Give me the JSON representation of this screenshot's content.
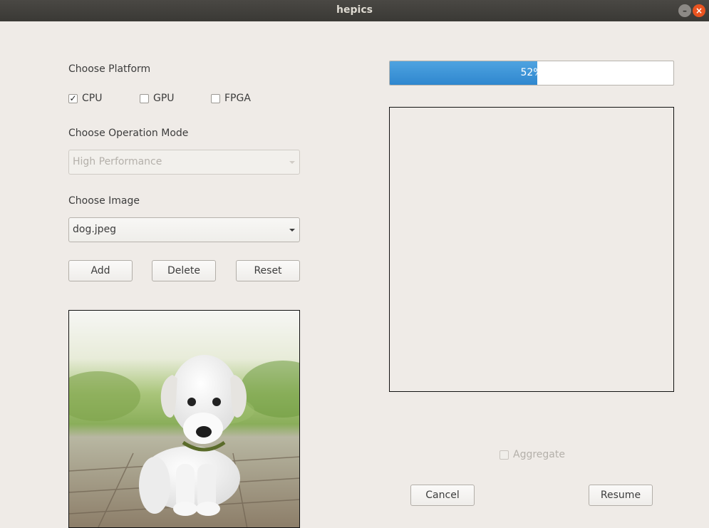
{
  "window": {
    "title": "hepics"
  },
  "platform": {
    "heading": "Choose Platform",
    "options": [
      {
        "label": "CPU",
        "checked": true
      },
      {
        "label": "GPU",
        "checked": false
      },
      {
        "label": "FPGA",
        "checked": false
      }
    ]
  },
  "mode": {
    "heading": "Choose Operation Mode",
    "selected": "High Performance",
    "enabled": false
  },
  "image": {
    "heading": "Choose Image",
    "selected": "dog.jpeg"
  },
  "actions": {
    "add": "Add",
    "delete": "Delete",
    "reset": "Reset"
  },
  "progress": {
    "percent": 52,
    "text": "52%"
  },
  "aggregate": {
    "label": "Aggregate",
    "checked": false,
    "enabled": false
  },
  "bottom": {
    "cancel": "Cancel",
    "resume": "Resume"
  },
  "check_mark": "✓",
  "colors": {
    "progress_fill": "#3a93d6",
    "accent_close": "#e95420"
  }
}
